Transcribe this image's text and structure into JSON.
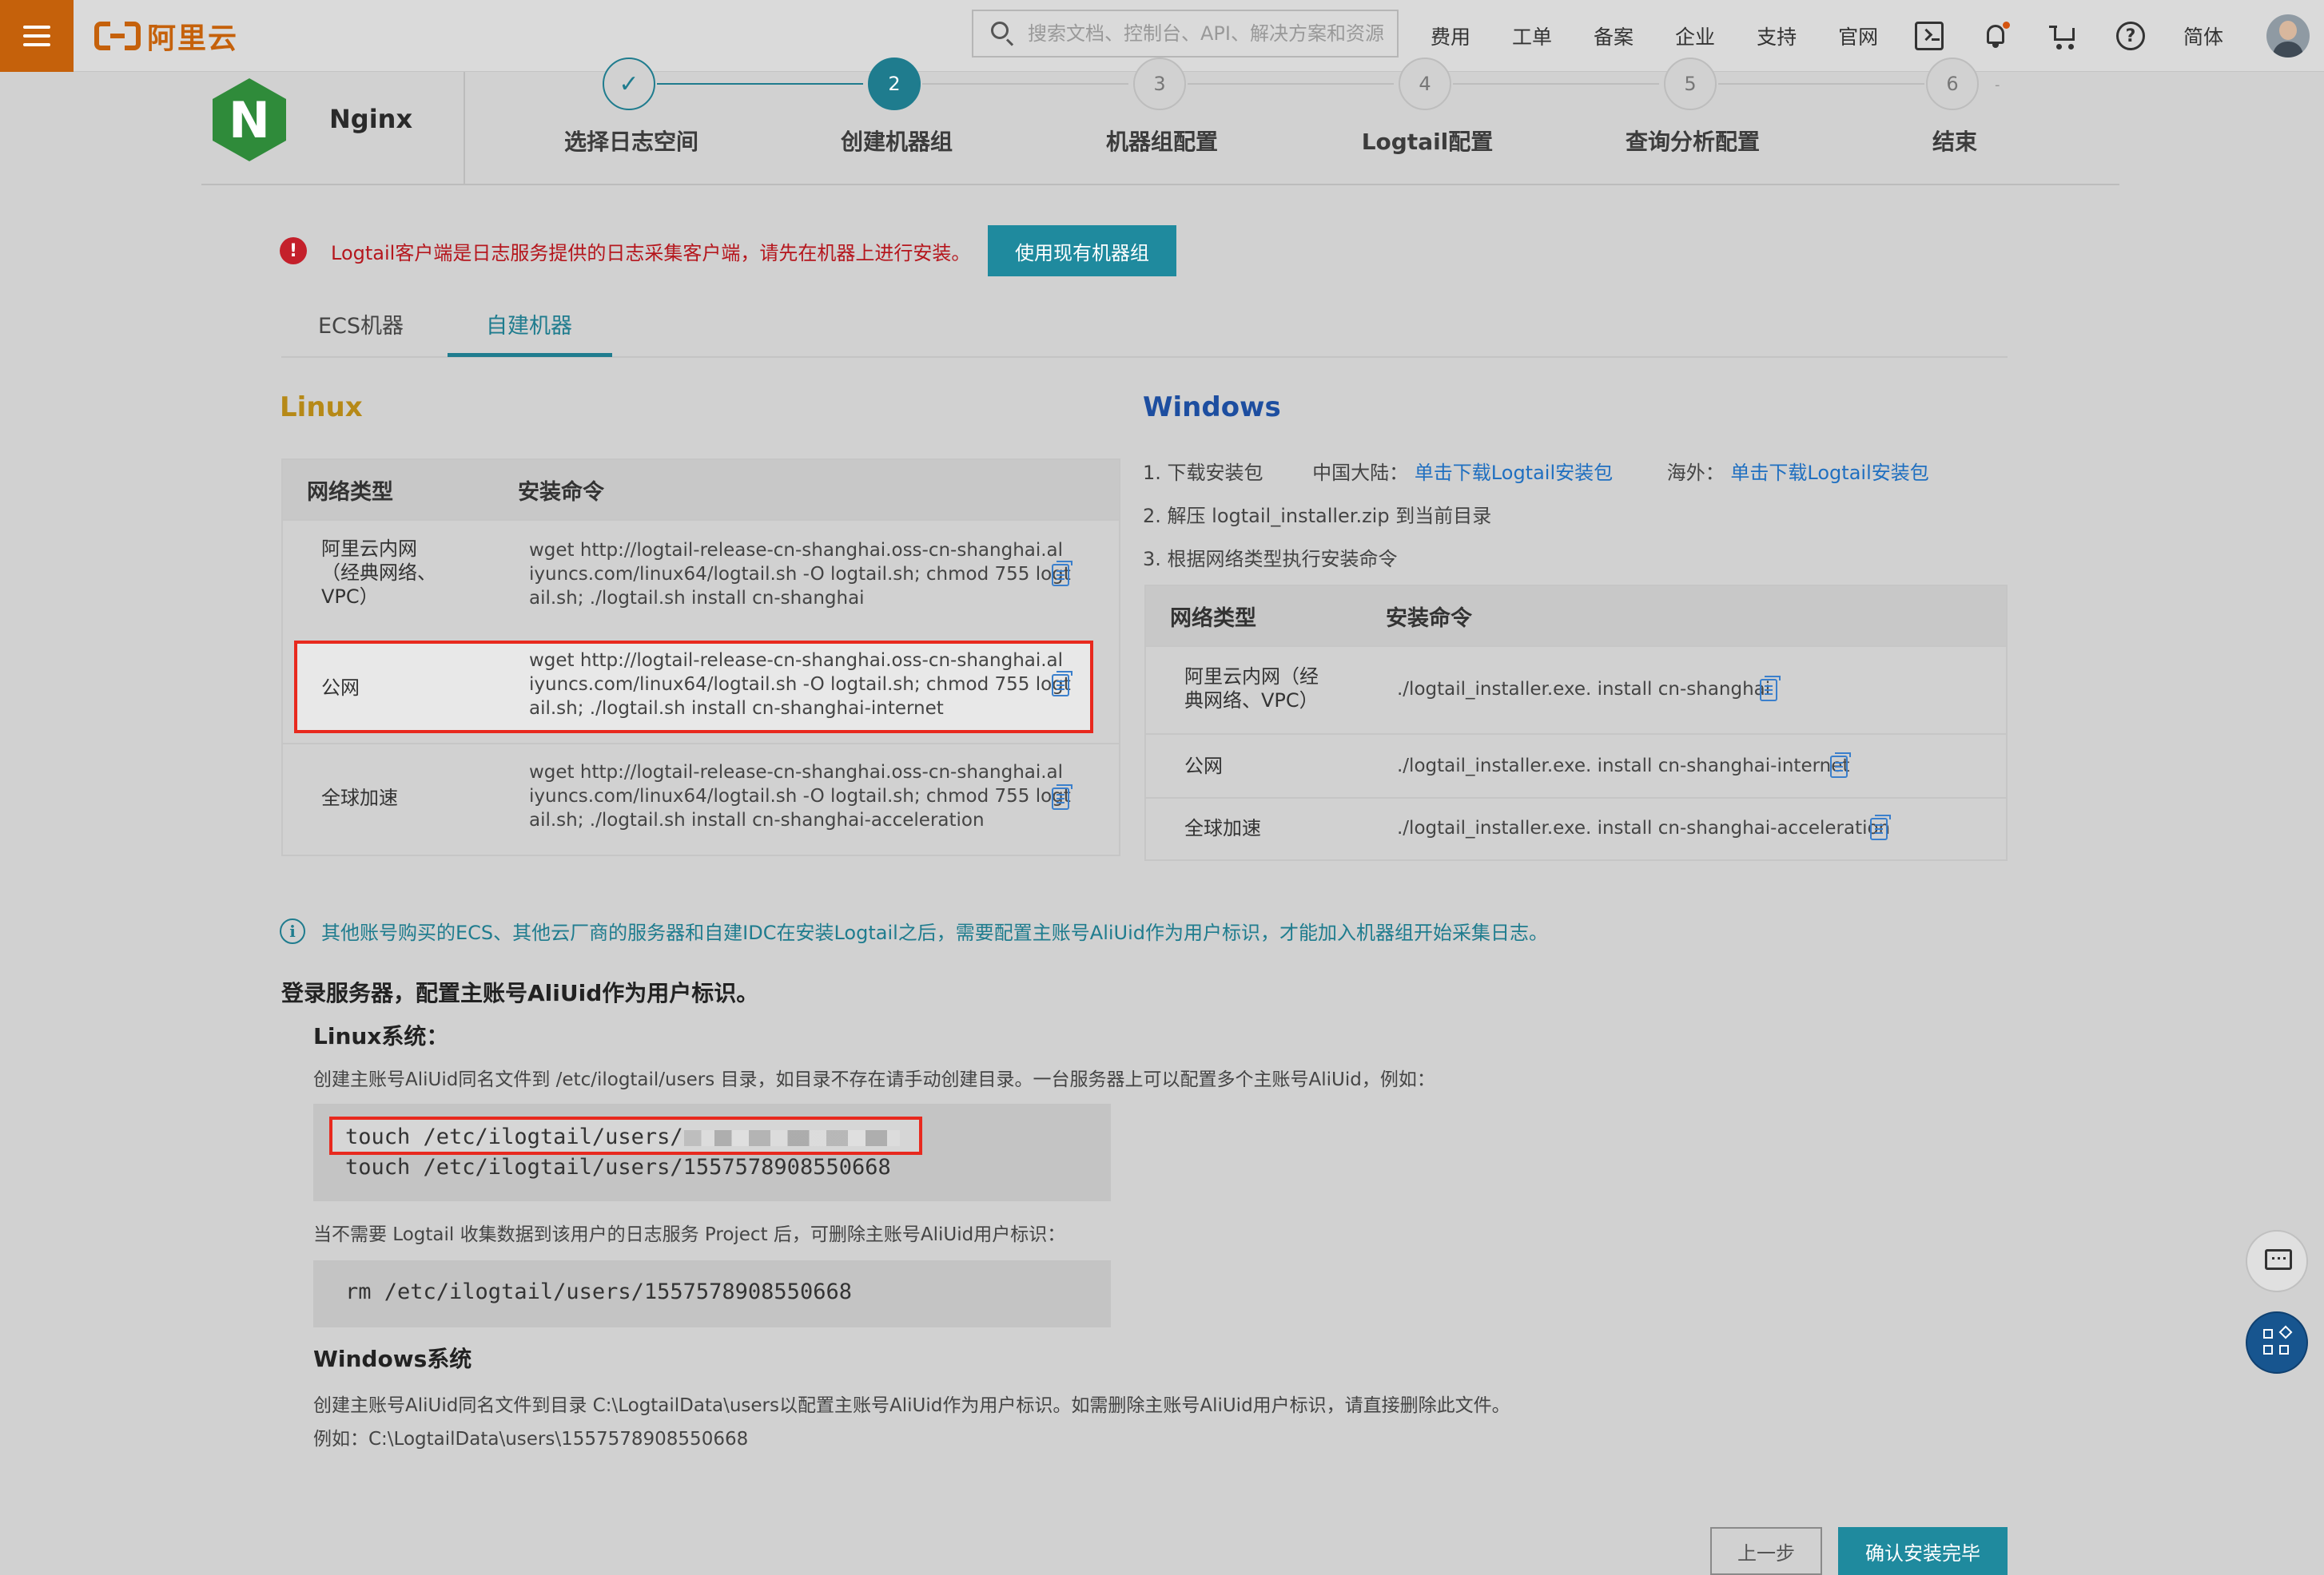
{
  "topbar": {
    "logo_text": "阿里云",
    "search_placeholder": "搜索文档、控制台、API、解决方案和资源",
    "links": [
      "费用",
      "工单",
      "备案",
      "企业",
      "支持",
      "官网"
    ],
    "lang": "简体",
    "icons": [
      "menu-icon",
      "terminal-icon",
      "bell-icon",
      "cart-icon",
      "help-icon",
      "avatar"
    ]
  },
  "product": {
    "name": "Nginx",
    "icon_letter": "N"
  },
  "steps": [
    {
      "num": "✓",
      "label": "选择日志空间",
      "state": "done"
    },
    {
      "num": "2",
      "label": "创建机器组",
      "state": "active"
    },
    {
      "num": "3",
      "label": "机器组配置",
      "state": "pending"
    },
    {
      "num": "4",
      "label": "Logtail配置",
      "state": "pending"
    },
    {
      "num": "5",
      "label": "查询分析配置",
      "state": "pending"
    },
    {
      "num": "6",
      "label": "结束",
      "state": "pending"
    }
  ],
  "alert": {
    "text": "Logtail客户端是日志服务提供的日志采集客户端，请先在机器上进行安装。",
    "button": "使用现有机器组"
  },
  "tabs": [
    {
      "label": "ECS机器",
      "active": false
    },
    {
      "label": "自建机器",
      "active": true
    }
  ],
  "linux": {
    "title": "Linux",
    "headers": [
      "网络类型",
      "安装命令"
    ],
    "rows": [
      {
        "type_lines": [
          "阿里云内网",
          "（经典网络、",
          "VPC）"
        ],
        "cmd_lines": [
          "wget http://logtail-release-cn-shanghai.oss-cn-shanghai.al",
          "iyuncs.com/linux64/logtail.sh -O logtail.sh; chmod 755 logt",
          "ail.sh; ./logtail.sh install cn-shanghai"
        ]
      },
      {
        "type_lines": [
          "公网"
        ],
        "cmd_lines": [
          "wget http://logtail-release-cn-shanghai.oss-cn-shanghai.al",
          "iyuncs.com/linux64/logtail.sh -O logtail.sh; chmod 755 logt",
          "ail.sh; ./logtail.sh install cn-shanghai-internet"
        ]
      },
      {
        "type_lines": [
          "全球加速"
        ],
        "cmd_lines": [
          "wget http://logtail-release-cn-shanghai.oss-cn-shanghai.al",
          "iyuncs.com/linux64/logtail.sh -O logtail.sh; chmod 755 logt",
          "ail.sh; ./logtail.sh install cn-shanghai-acceleration"
        ]
      }
    ]
  },
  "windows": {
    "title": "Windows",
    "step1_prefix": "1. 下载安装包",
    "step1_cn_label": "中国大陆：",
    "step1_cn_link": "单击下载Logtail安装包",
    "step1_os_label": "海外：",
    "step1_os_link": "单击下载Logtail安装包",
    "step2": "2. 解压 logtail_installer.zip 到当前目录",
    "step3": "3. 根据网络类型执行安装命令",
    "headers": [
      "网络类型",
      "安装命令"
    ],
    "rows": [
      {
        "type_lines": [
          "阿里云内网（经",
          "典网络、VPC）"
        ],
        "cmd": "./logtail_installer.exe. install cn-shanghai"
      },
      {
        "type_lines": [
          "公网"
        ],
        "cmd": "./logtail_installer.exe. install cn-shanghai-internet"
      },
      {
        "type_lines": [
          "全球加速"
        ],
        "cmd": "./logtail_installer.exe. install cn-shanghai-acceleration"
      }
    ]
  },
  "info": {
    "text": "其他账号购买的ECS、其他云厂商的服务器和自建IDC在安装Logtail之后，需要配置主账号AliUid作为用户标识，才能加入机器组开始采集日志。"
  },
  "config": {
    "heading": "登录服务器，配置主账号AliUid作为用户标识。",
    "linux_title": "Linux系统：",
    "linux_desc": "创建主账号AliUid同名文件到 /etc/ilogtail/users 目录，如目录不存在请手动创建目录。一台服务器上可以配置多个主账号AliUid，例如：",
    "code1_line1": "touch /etc/ilogtail/users/",
    "code1_line2": "touch /etc/ilogtail/users/1557578908550668",
    "remove_desc": "当不需要 Logtail 收集数据到该用户的日志服务 Project 后，可删除主账号AliUid用户标识：",
    "code2": "rm /etc/ilogtail/users/1557578908550668",
    "windows_title": "Windows系统",
    "windows_desc": "创建主账号AliUid同名文件到目录 C:\\LogtailData\\users以配置主账号AliUid作为用户标识。如需删除主账号AliUid用户标识，请直接删除此文件。",
    "windows_example": "例如：C:\\LogtailData\\users\\1557578908550668"
  },
  "footer": {
    "prev": "上一步",
    "confirm": "确认安装完毕"
  },
  "colors": {
    "accent": "#1f8a9e",
    "brand": "#c5610b",
    "error": "#b5161d",
    "linux_title": "#b68917",
    "windows_title": "#1d4ea0"
  }
}
